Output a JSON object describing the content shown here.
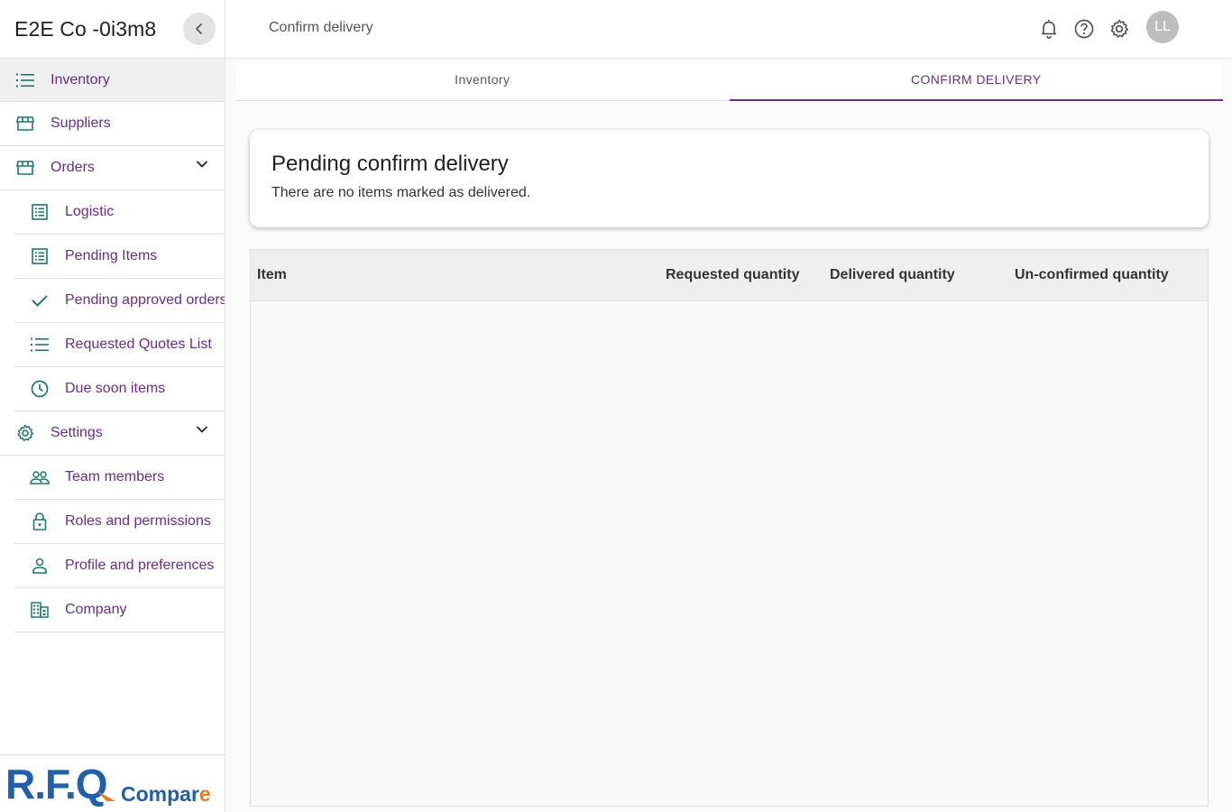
{
  "app": {
    "company_name": "E2E Co -0i3m8",
    "page_title": "Confirm delivery",
    "avatar_initials": "LL"
  },
  "sidebar": {
    "items": [
      {
        "label": "Inventory",
        "icon": "list-icon"
      },
      {
        "label": "Suppliers",
        "icon": "store-icon"
      },
      {
        "label": "Orders",
        "icon": "store-icon"
      },
      {
        "label": "Logistic",
        "icon": "receipt-icon"
      },
      {
        "label": "Pending Items",
        "icon": "receipt-icon"
      },
      {
        "label": "Pending approved orders",
        "icon": "check-icon"
      },
      {
        "label": "Requested Quotes List",
        "icon": "list-icon"
      },
      {
        "label": "Due soon items",
        "icon": "clock-icon"
      },
      {
        "label": "Settings",
        "icon": "gear-icon"
      },
      {
        "label": "Team members",
        "icon": "people-icon"
      },
      {
        "label": "Roles and permissions",
        "icon": "lock-icon"
      },
      {
        "label": "Profile and preferences",
        "icon": "person-icon"
      },
      {
        "label": "Company",
        "icon": "building-icon"
      }
    ],
    "logo": {
      "primary": "R.F.Q",
      "secondary": "Compare"
    }
  },
  "tabs": [
    {
      "label": "Inventory"
    },
    {
      "label": "CONFIRM DELIVERY"
    }
  ],
  "card": {
    "title": "Pending confirm delivery",
    "message": "There are no items marked as delivered."
  },
  "table": {
    "columns": [
      "Item",
      "Requested quantity",
      "Delivered quantity",
      "Un-confirmed quantity"
    ]
  },
  "colors": {
    "accent": "#6a2a8e",
    "icon": "#1a7a6a",
    "logo_blue": "#1f5fb0",
    "logo_orange": "#f07820"
  }
}
